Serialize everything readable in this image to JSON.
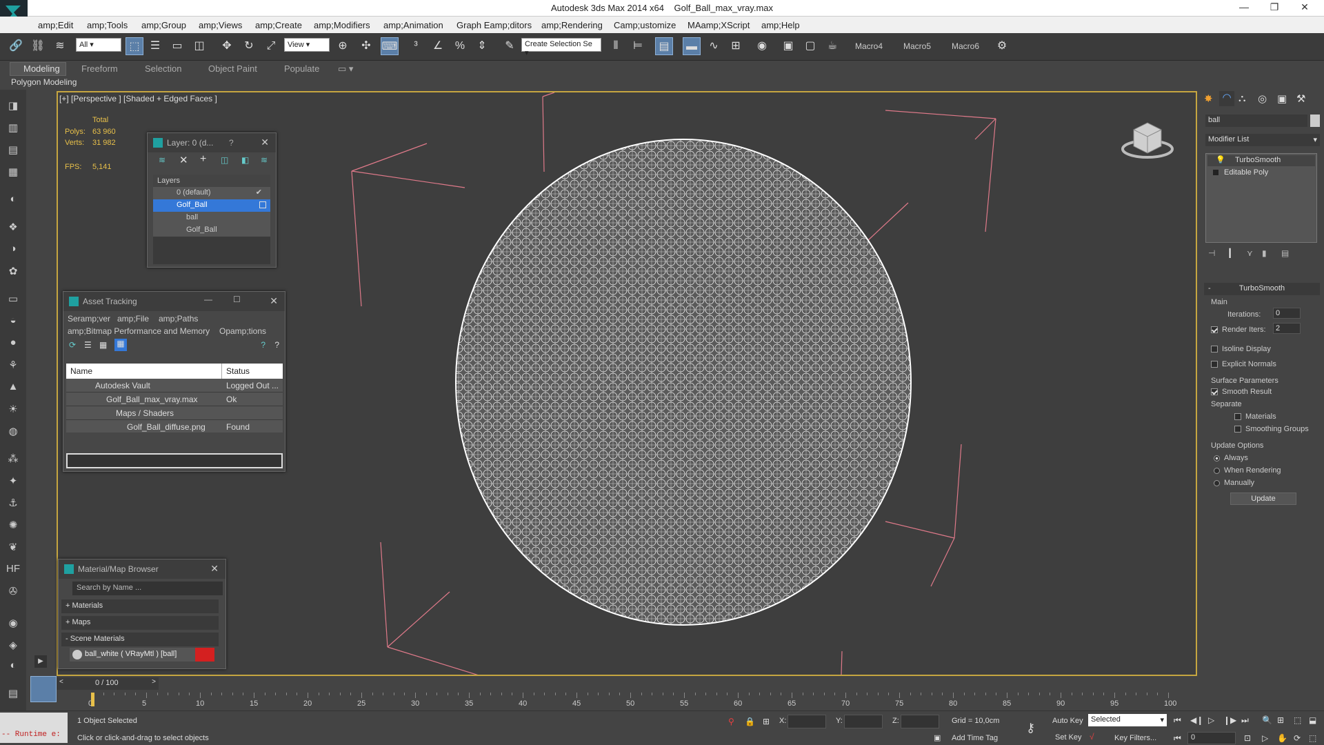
{
  "app": {
    "title_left": "Autodesk 3ds Max  2014 x64",
    "title_file": "Golf_Ball_max_vray.max"
  },
  "menu": [
    "amp;Edit",
    "amp;Tools",
    "amp;Group",
    "amp;Views",
    "amp;Create",
    "amp;Modifiers",
    "amp;Animation",
    "Graph Eamp;ditors",
    "amp;Rendering",
    "Camp;ustomize",
    "MAamp;XScript",
    "amp;Help"
  ],
  "toolbar": {
    "selection_filter": "All",
    "ref_coord": "View",
    "named_selection": "Create Selection Se",
    "macros": [
      "Macro4",
      "Macro5",
      "Macro6"
    ]
  },
  "ribbon": {
    "tabs": [
      "Modeling",
      "Freeform",
      "Selection",
      "Object Paint",
      "Populate"
    ],
    "panel_label": "Polygon Modeling"
  },
  "viewport": {
    "label": "[+] [Perspective ] [Shaded + Edged Faces ]",
    "stats": {
      "total_label": "Total",
      "polys_label": "Polys:",
      "polys": "63 960",
      "verts_label": "Verts:",
      "verts": "31 982",
      "fps_label": "FPS:",
      "fps": "5,141"
    }
  },
  "layer_dialog": {
    "title": "Layer: 0 (d...",
    "help": "?",
    "header": "Layers",
    "items": [
      "0 (default)",
      "Golf_Ball",
      "ball",
      "Golf_Ball"
    ]
  },
  "asset_tracking": {
    "title": "Asset Tracking",
    "menu": [
      "Seramp;ver",
      "amp;File",
      "amp;Paths",
      "amp;Bitmap Performance and Memory",
      "Opamp;tions"
    ],
    "columns": [
      "Name",
      "Status"
    ],
    "rows": [
      {
        "name": "Autodesk Vault",
        "status": "Logged Out ..."
      },
      {
        "name": "Golf_Ball_max_vray.max",
        "status": "Ok"
      },
      {
        "name": "Maps / Shaders",
        "status": ""
      },
      {
        "name": "Golf_Ball_diffuse.png",
        "status": "Found"
      }
    ]
  },
  "material_browser": {
    "title": "Material/Map Browser",
    "search_placeholder": "Search by Name ...",
    "groups": [
      "+ Materials",
      "+ Maps",
      "- Scene Materials"
    ],
    "material": "ball_white  ( VRayMtl )  [ball]"
  },
  "command_panel": {
    "object_name": "ball",
    "modifier_list": "Modifier List",
    "stack": [
      "TurboSmooth",
      "Editable Poly"
    ],
    "rollout": "TurboSmooth",
    "main_label": "Main",
    "iterations_label": "Iterations:",
    "iterations": "0",
    "render_iters_label": "Render Iters:",
    "render_iters": "2",
    "isoline": "Isoline Display",
    "explicit": "Explicit Normals",
    "surface_params": "Surface Parameters",
    "smooth_result": "Smooth Result",
    "separate": "Separate",
    "materials": "Materials",
    "smoothing_groups": "Smoothing Groups",
    "update_options": "Update Options",
    "always": "Always",
    "when_rendering": "When Rendering",
    "manually": "Manually",
    "update_btn": "Update"
  },
  "timeline": {
    "frame": "0 / 100",
    "ticks": [
      "0",
      "5",
      "10",
      "15",
      "20",
      "25",
      "30",
      "35",
      "40",
      "45",
      "50",
      "55",
      "60",
      "65",
      "70",
      "75",
      "80",
      "85",
      "90",
      "95",
      "100"
    ]
  },
  "status": {
    "maxscript": "-- Runtime e:",
    "selected": "1 Object Selected",
    "prompt": "Click or click-and-drag to select objects",
    "x": "X:",
    "y": "Y:",
    "z": "Z:",
    "grid": "Grid = 10,0cm",
    "add_time_tag": "Add Time Tag",
    "auto_key": "Auto Key",
    "set_key": "Set Key",
    "selected_dd": "Selected",
    "key_filters": "Key Filters...",
    "frame_field": "0"
  }
}
